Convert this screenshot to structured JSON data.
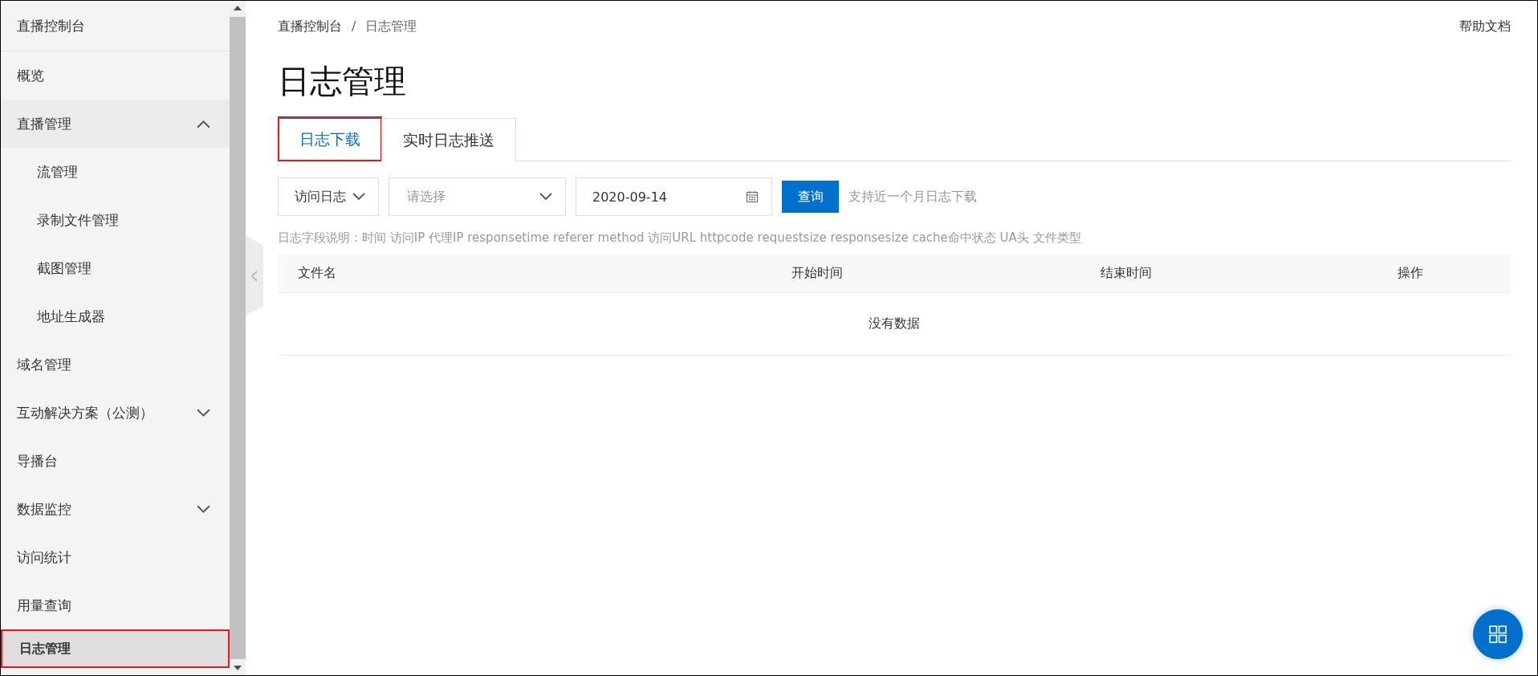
{
  "sidebar": {
    "title": "直播控制台",
    "items": [
      {
        "label": "概览",
        "kind": "item",
        "selected": false,
        "highlighted": false
      },
      {
        "label": "直播管理",
        "kind": "group",
        "expanded": true,
        "selected": false,
        "highlighted": false,
        "children": [
          {
            "label": "流管理",
            "selected": false
          },
          {
            "label": "录制文件管理",
            "selected": false
          },
          {
            "label": "截图管理",
            "selected": false
          },
          {
            "label": "地址生成器",
            "selected": false
          }
        ]
      },
      {
        "label": "域名管理",
        "kind": "item",
        "selected": false,
        "highlighted": false
      },
      {
        "label": "互动解决方案（公测）",
        "kind": "group",
        "expanded": false,
        "selected": false,
        "highlighted": false
      },
      {
        "label": "导播台",
        "kind": "item",
        "selected": false,
        "highlighted": false
      },
      {
        "label": "数据监控",
        "kind": "group",
        "expanded": false,
        "selected": false,
        "highlighted": false
      },
      {
        "label": "访问统计",
        "kind": "item",
        "selected": false,
        "highlighted": false
      },
      {
        "label": "用量查询",
        "kind": "item",
        "selected": false,
        "highlighted": false
      },
      {
        "label": "日志管理",
        "kind": "item",
        "selected": true,
        "highlighted": true
      }
    ]
  },
  "breadcrumb": [
    "直播控制台",
    "/",
    "日志管理"
  ],
  "help_link": "帮助文档",
  "page_title": "日志管理",
  "tabs": [
    {
      "label": "日志下载",
      "selected": true,
      "highlighted": true
    },
    {
      "label": "实时日志推送",
      "selected": false,
      "highlighted": false
    }
  ],
  "filters": {
    "log_type": {
      "value": "访问日志"
    },
    "domain": {
      "placeholder": "请选择"
    },
    "date": {
      "value": "2020-09-14"
    },
    "query_button": "查询",
    "hint": "支持近一个月日志下载"
  },
  "field_description": "日志字段说明：时间 访问IP 代理IP responsetime referer method 访问URL httpcode requestsize responsesize cache命中状态 UA头 文件类型",
  "table": {
    "columns": [
      "文件名",
      "开始时间",
      "结束时间",
      "操作"
    ],
    "empty_text": "没有数据"
  }
}
